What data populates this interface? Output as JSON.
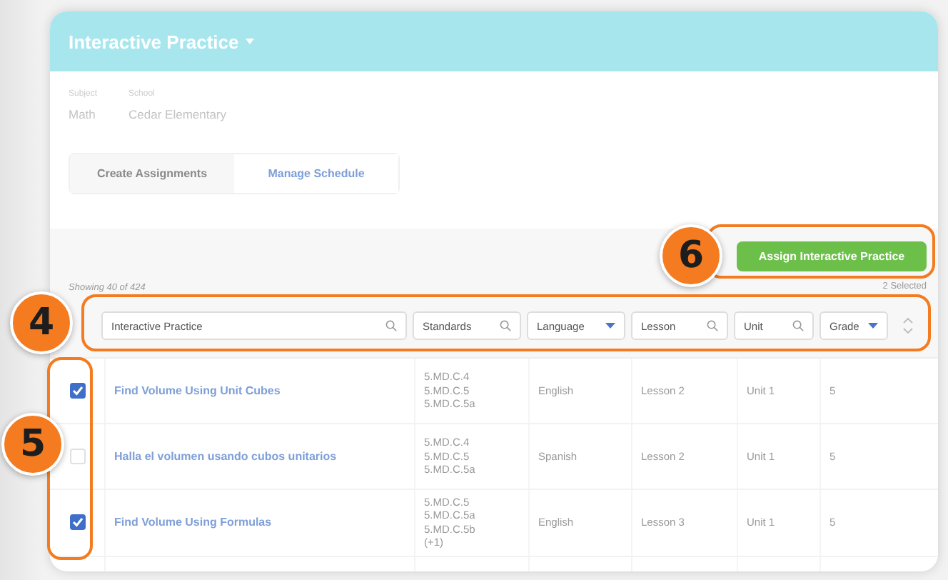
{
  "header": {
    "title": "Interactive Practice"
  },
  "info": [
    {
      "label": "Subject",
      "value": "Math"
    },
    {
      "label": "School",
      "value": "Cedar Elementary"
    }
  ],
  "tabs": [
    {
      "label": "Create Assignments",
      "selected": true
    },
    {
      "label": "Manage Schedule",
      "selected": false
    }
  ],
  "results": {
    "showing": "Showing 40 of 424",
    "selected_count": "2 Selected"
  },
  "assign_button": "Assign Interactive Practice",
  "filters": [
    {
      "kind": "search",
      "label": "Interactive Practice"
    },
    {
      "kind": "search",
      "label": "Standards"
    },
    {
      "kind": "dropdown",
      "label": "Language"
    },
    {
      "kind": "search",
      "label": "Lesson"
    },
    {
      "kind": "search",
      "label": "Unit"
    },
    {
      "kind": "dropdown",
      "label": "Grade"
    }
  ],
  "rows": [
    {
      "checked": true,
      "title": "Find Volume Using Unit Cubes",
      "standards": [
        "5.MD.C.4",
        "5.MD.C.5",
        "5.MD.C.5a"
      ],
      "language": "English",
      "lesson": "Lesson 2",
      "unit": "Unit 1",
      "grade": "5"
    },
    {
      "checked": false,
      "title": "Halla el volumen usando cubos unitarios",
      "standards": [
        "5.MD.C.4",
        "5.MD.C.5",
        "5.MD.C.5a"
      ],
      "language": "Spanish",
      "lesson": "Lesson 2",
      "unit": "Unit 1",
      "grade": "5"
    },
    {
      "checked": true,
      "title": "Find Volume Using Formulas",
      "standards": [
        "5.MD.C.5",
        "5.MD.C.5a",
        "5.MD.C.5b",
        "(+1)"
      ],
      "language": "English",
      "lesson": "Lesson 3",
      "unit": "Unit 1",
      "grade": "5"
    }
  ],
  "callouts": [
    {
      "kind": "filters",
      "number": "4"
    },
    {
      "kind": "checkboxes",
      "number": "5"
    },
    {
      "kind": "assign",
      "number": "6"
    }
  ]
}
